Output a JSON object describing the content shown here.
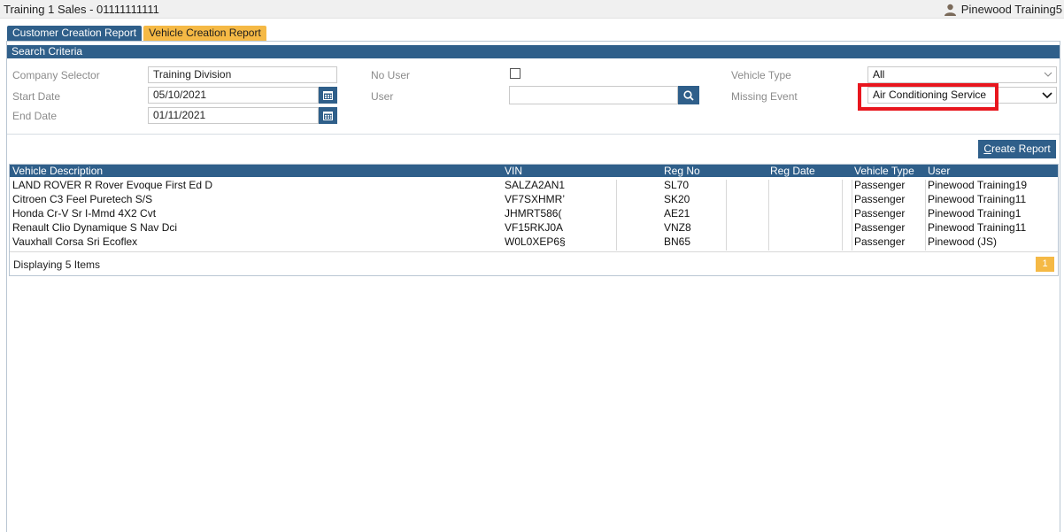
{
  "header": {
    "title": "Training 1 Sales - 01111111111",
    "user_name": "Pinewood Training5",
    "user_icon": "person-icon"
  },
  "tabs": [
    {
      "label": "Customer Creation Report",
      "active": false
    },
    {
      "label": "Vehicle Creation Report",
      "active": true
    }
  ],
  "search": {
    "section_title": "Search Criteria",
    "company_selector": {
      "label": "Company Selector",
      "value": "Training Division"
    },
    "start_date": {
      "label": "Start Date",
      "value": "05/10/2021"
    },
    "end_date": {
      "label": "End Date",
      "value": "01/11/2021"
    },
    "no_user": {
      "label": "No User",
      "checked": false
    },
    "user": {
      "label": "User",
      "value": ""
    },
    "vehicle_type": {
      "label": "Vehicle Type",
      "value": "All"
    },
    "missing_event": {
      "label": "Missing Event",
      "value": "Air Conditioning Service"
    },
    "icons": {
      "calendar": "calendar-icon",
      "search": "search-icon",
      "dropdown": "chevron-down-icon"
    }
  },
  "actions": {
    "create_report_underlined": "C",
    "create_report_rest": "reate Report"
  },
  "grid": {
    "columns": [
      "Vehicle Description",
      "VIN",
      "Reg No",
      "Reg Date",
      "Vehicle Type",
      "User"
    ],
    "rows": [
      [
        "LAND ROVER R Rover Evoque First Ed D",
        "SALZA2AN1",
        "SL70",
        "",
        "Passenger",
        "Pinewood Training19"
      ],
      [
        "Citroen C3 Feel Puretech S/S",
        "VF7SXHMR’",
        "SK20",
        "",
        "Passenger",
        "Pinewood Training11"
      ],
      [
        "Honda Cr-V Sr I-Mmd 4X2 Cvt",
        "JHMRT586(",
        "AE21",
        "",
        "Passenger",
        "Pinewood Training1"
      ],
      [
        "Renault Clio Dynamique S Nav Dci",
        "VF15RKJ0A",
        "VNZ8",
        "",
        "Passenger",
        "Pinewood Training11"
      ],
      [
        "Vauxhall Corsa Sri Ecoflex",
        "W0L0XEP6§",
        "BN65",
        "",
        "Passenger",
        "Pinewood (JS)"
      ]
    ],
    "footer_text": "Displaying 5 Items",
    "page": "1"
  },
  "colors": {
    "header_blue": "#2f5f8a",
    "tab_active": "#f5b945",
    "highlight": "#e8161e",
    "page_badge": "#f5b945"
  }
}
